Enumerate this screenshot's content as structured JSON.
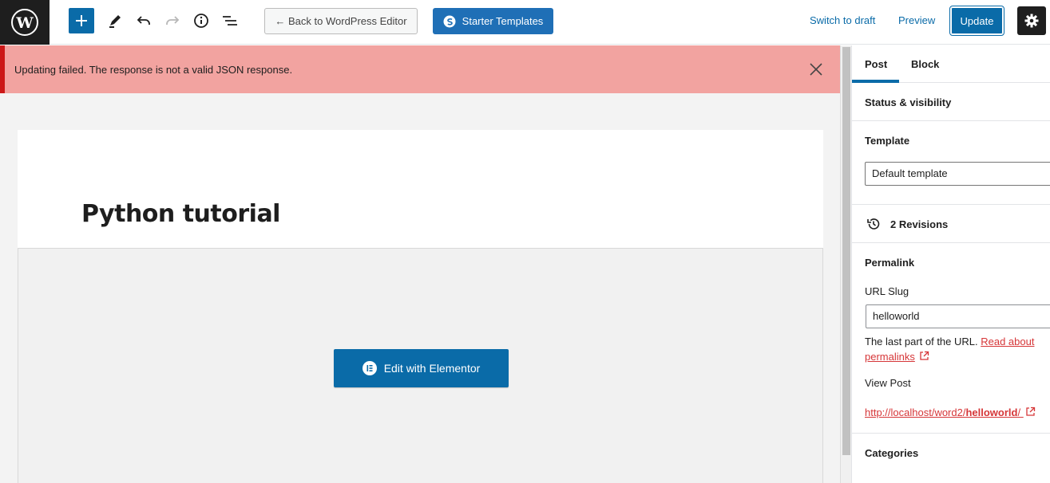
{
  "toolbar": {
    "back_label": "← Back to WordPress Editor",
    "starter_label": "Starter Templates",
    "switch_draft_label": "Switch to draft",
    "preview_label": "Preview",
    "update_label": "Update"
  },
  "notice": {
    "message": "Updating failed. The response is not a valid JSON response."
  },
  "post": {
    "title": "Python tutorial",
    "elementor_label": "Edit with Elementor"
  },
  "sidebar": {
    "tab_post": "Post",
    "tab_block": "Block",
    "status_title": "Status & visibility",
    "template_title": "Template",
    "template_value": "Default template",
    "revisions_label": "2 Revisions",
    "permalink_title": "Permalink",
    "url_slug_label": "URL Slug",
    "url_slug_value": "helloworld",
    "help_prefix": "The last part of the URL. ",
    "help_link": "Read about permalinks",
    "view_post_label": "View Post",
    "view_url_prefix": "http://localhost/word2/",
    "view_url_slug": "helloworld",
    "view_url_suffix": "/",
    "categories_title": "Categories"
  },
  "colors": {
    "accent": "#0a6ba8",
    "notice_bg": "#f2a3a0",
    "notice_border": "#cc1818",
    "link_red": "#d63638"
  }
}
